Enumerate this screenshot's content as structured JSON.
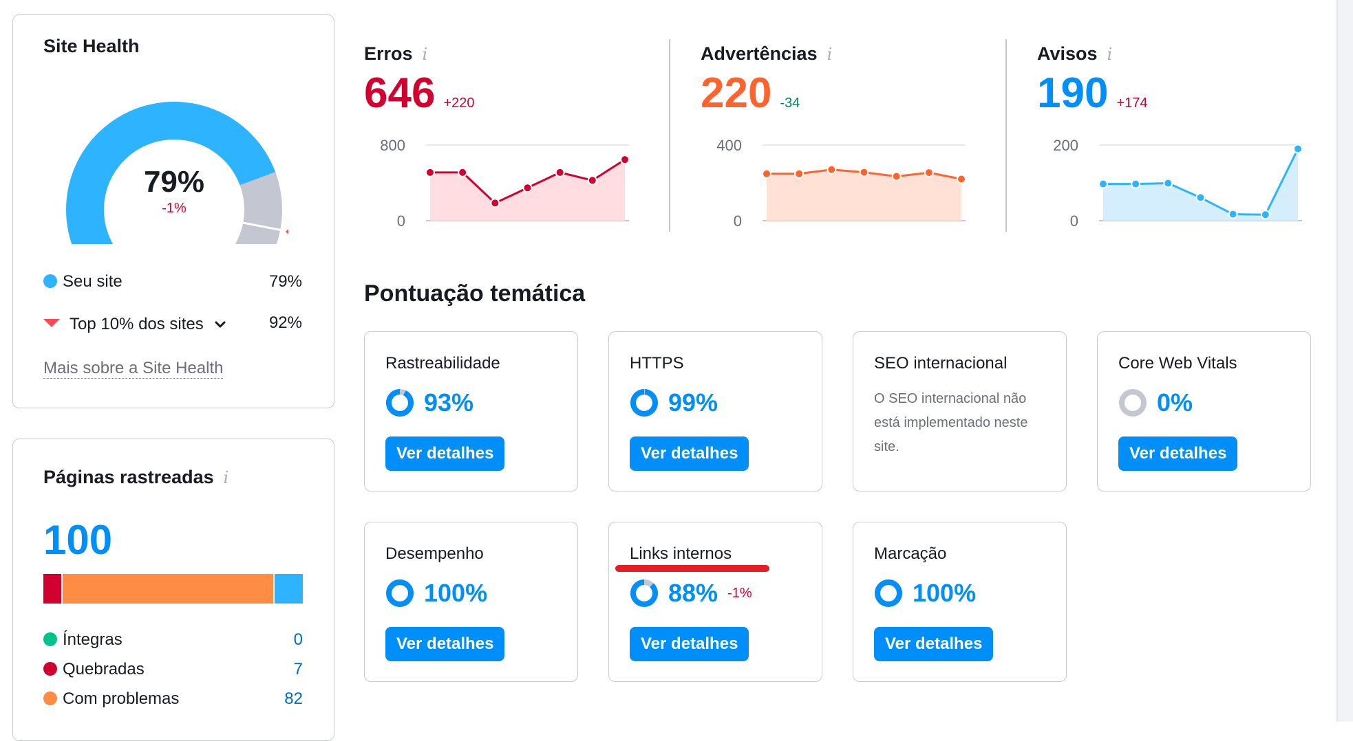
{
  "colors": {
    "primary": "#008ff8",
    "site_blue": "#2db3ff",
    "gauge_gray": "#c4c7d1",
    "error_red": "#d1002f",
    "warning_orange": "#ff642d",
    "notice_blue": "#008ff8",
    "positive_green": "#00875a",
    "healthy_green": "#00c28a",
    "broken_red": "#d1002f",
    "issues_orange": "#ff8c43",
    "redirect_blue": "#2db3ff",
    "top10_red": "#ff4953",
    "annotation_red": "#e31e24"
  },
  "site_health": {
    "title": "Site Health",
    "score": 79,
    "score_label": "79%",
    "delta": "-1%",
    "top10_score": 92,
    "legend": [
      {
        "label": "Seu site",
        "value": "79%",
        "marker": "dot"
      },
      {
        "label": "Top 10% dos sites",
        "value": "92%",
        "marker": "triangle-down",
        "has_dropdown": true
      }
    ],
    "more_link": "Mais sobre a Site Health"
  },
  "crawled_pages": {
    "title": "Páginas rastreadas",
    "info_icon": "i",
    "total": "100",
    "bar": [
      {
        "name": "broken",
        "value": 7,
        "color": "#d1002f"
      },
      {
        "name": "issues",
        "value": 82,
        "color": "#ff8c43"
      },
      {
        "name": "other",
        "value": 11,
        "color": "#2db3ff"
      }
    ],
    "rows": [
      {
        "label": "Íntegras",
        "value": "0",
        "color": "#00c28a"
      },
      {
        "label": "Quebradas",
        "value": "7",
        "color": "#d1002f"
      },
      {
        "label": "Com problemas",
        "value": "82",
        "color": "#ff8c43"
      }
    ]
  },
  "metrics": [
    {
      "title": "Erros",
      "info_icon": "i",
      "value": "646",
      "delta": "+220",
      "value_color": "#d1002f",
      "delta_color": "#d1002f",
      "line_color": "#d1002f",
      "fill_color": "#ffdde0"
    },
    {
      "title": "Advertências",
      "info_icon": "i",
      "value": "220",
      "delta": "-34",
      "value_color": "#ff642d",
      "delta_color": "#00875a",
      "line_color": "#ff642d",
      "fill_color": "#ffe1d6"
    },
    {
      "title": "Avisos",
      "info_icon": "i",
      "value": "190",
      "delta": "+174",
      "value_color": "#008ff8",
      "delta_color": "#d1002f",
      "line_color": "#2db3ff",
      "fill_color": "#d5eefe"
    }
  ],
  "chart_data": [
    {
      "type": "area",
      "title": "Erros",
      "x": [
        1,
        2,
        3,
        4,
        5,
        6,
        7
      ],
      "values": [
        510,
        510,
        186,
        347,
        510,
        426,
        646
      ],
      "ylim": [
        0,
        800
      ],
      "yticks": [
        "800",
        "0"
      ],
      "grid": true
    },
    {
      "type": "area",
      "title": "Advertências",
      "x": [
        1,
        2,
        3,
        4,
        5,
        6,
        7
      ],
      "values": [
        248,
        248,
        270,
        256,
        234,
        254,
        220
      ],
      "ylim": [
        0,
        400
      ],
      "yticks": [
        "400",
        "0"
      ],
      "grid": true
    },
    {
      "type": "area",
      "title": "Avisos",
      "x": [
        1,
        2,
        3,
        4,
        5,
        6,
        7
      ],
      "values": [
        97,
        97,
        99,
        61,
        17,
        16,
        190
      ],
      "ylim": [
        0,
        200
      ],
      "yticks": [
        "200",
        "0"
      ],
      "grid": true
    }
  ],
  "thematic": {
    "title": "Pontuação temática",
    "button_label": "Ver detalhes",
    "cards": [
      {
        "name": "Rastreabilidade",
        "score": 93,
        "label": "93%",
        "delta": "",
        "has_button": true
      },
      {
        "name": "HTTPS",
        "score": 99,
        "label": "99%",
        "delta": "",
        "has_button": true
      },
      {
        "name": "SEO internacional",
        "description": "O SEO internacional não está implementado neste site.",
        "has_button": false
      },
      {
        "name": "Core Web Vitals",
        "score": 0,
        "label": "0%",
        "delta": "",
        "has_button": true
      },
      {
        "name": "Desempenho",
        "score": 100,
        "label": "100%",
        "delta": "",
        "has_button": true
      },
      {
        "name": "Links internos",
        "score": 88,
        "label": "88%",
        "delta": "-1%",
        "has_button": true,
        "annotated": true
      },
      {
        "name": "Marcação",
        "score": 100,
        "label": "100%",
        "delta": "",
        "has_button": true
      }
    ]
  }
}
